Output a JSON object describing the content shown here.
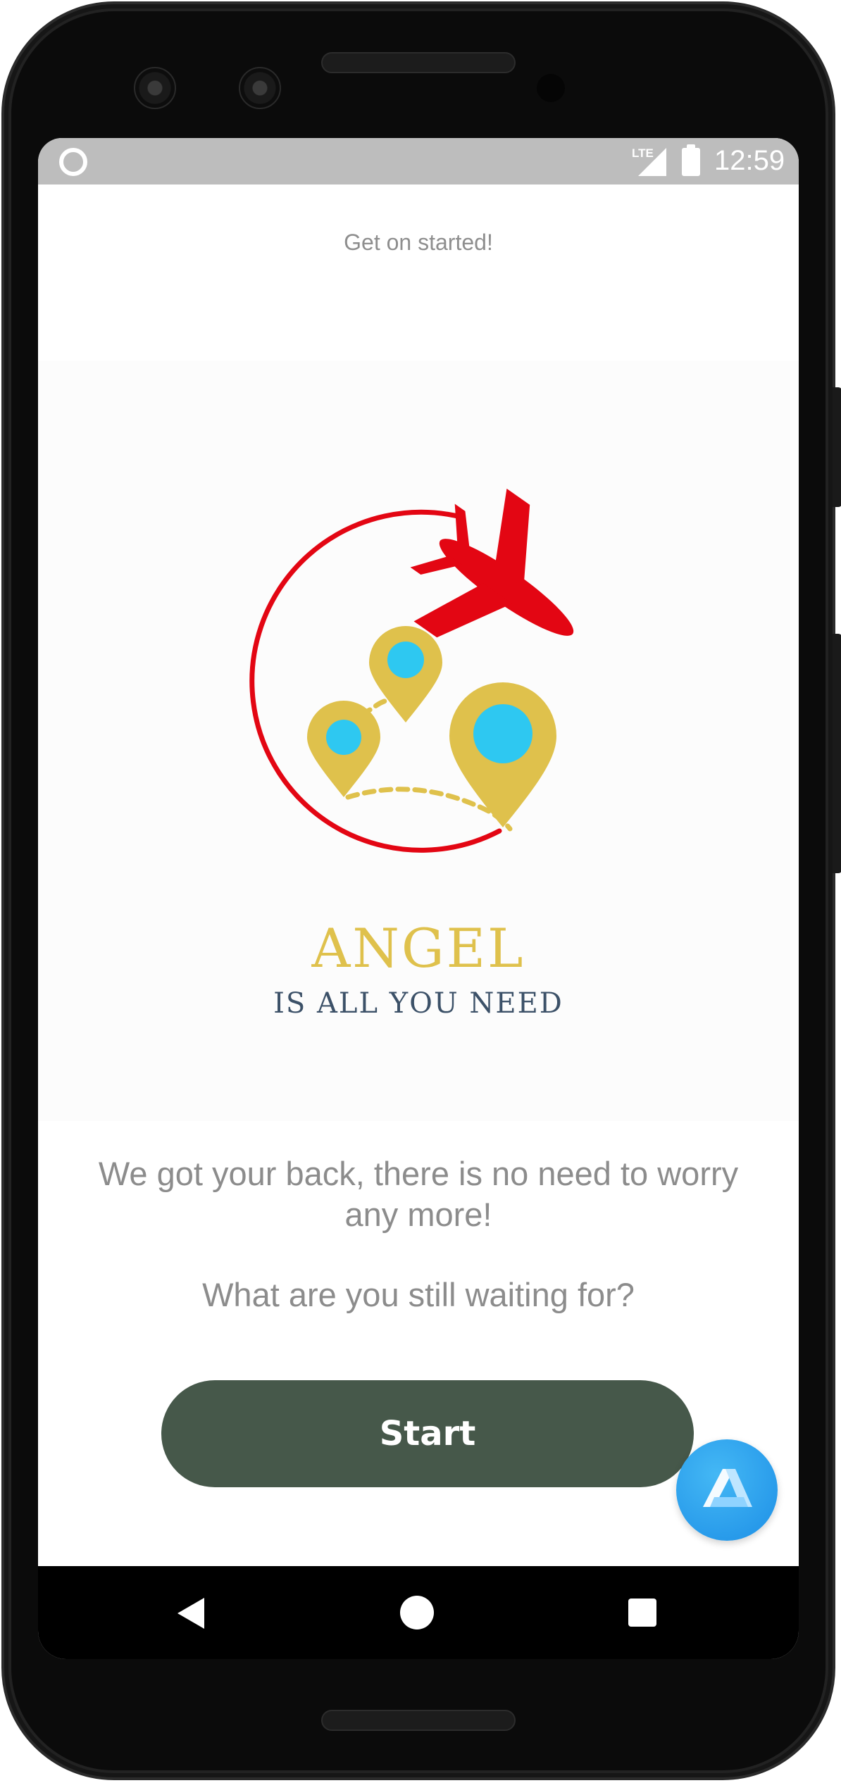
{
  "status_bar": {
    "network": "LTE",
    "time": "12:59"
  },
  "header": {
    "title": "Get on started!"
  },
  "logo": {
    "title": "ANGEL",
    "subtitle": "IS ALL YOU NEED",
    "colors": {
      "circle": "#e30613",
      "plane": "#e30613",
      "pin": "#dfc14c",
      "pin_center": "#2ec8f1",
      "title": "#dfc14c",
      "subtitle": "#3c5168"
    }
  },
  "main": {
    "message": "We got your back, there is no need to worry any more!",
    "question": "What are you still waiting for?",
    "start_label": "Start"
  },
  "fab": {
    "icon": "app-logo-icon",
    "color": "#1d8fe6"
  },
  "nav": {
    "back_icon": "back-triangle-icon",
    "home_icon": "home-circle-icon",
    "recents_icon": "recents-square-icon"
  },
  "theme": {
    "button_bg": "#46584a",
    "text_muted": "#8c8c8c",
    "status_bar_bg": "#bdbdbd"
  }
}
